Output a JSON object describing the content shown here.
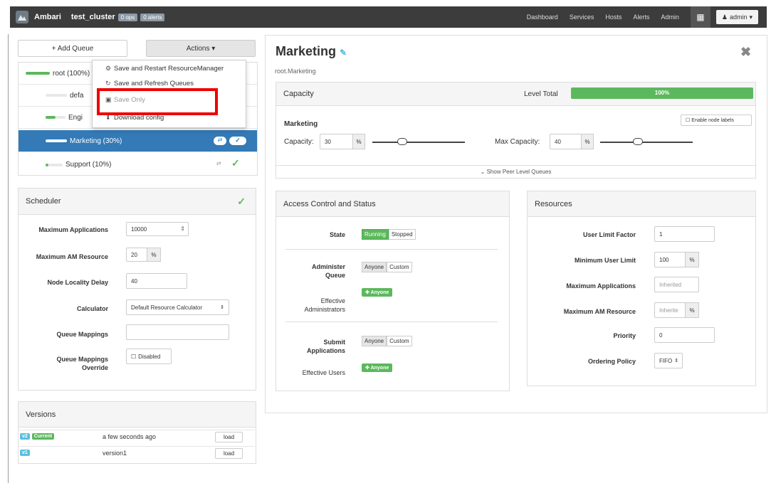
{
  "topbar": {
    "brand": "Ambari",
    "cluster": "test_cluster",
    "ops_badge": "0 ops",
    "alerts_badge": "0 alerts",
    "nav": [
      "Dashboard",
      "Services",
      "Hosts",
      "Alerts",
      "Admin"
    ],
    "admin": "admin"
  },
  "queues": {
    "add_queue": "+ Add Queue",
    "actions": "Actions ▾",
    "items": [
      {
        "label": "root (100%)"
      },
      {
        "label": "defa"
      },
      {
        "label": "Engi"
      },
      {
        "label": "Marketing (30%)"
      },
      {
        "label": "Support (10%)"
      }
    ]
  },
  "actions_menu": {
    "items": [
      "Save and Restart ResourceManager",
      "Save and Refresh Queues",
      "Save Only",
      "Download config"
    ]
  },
  "scheduler": {
    "title": "Scheduler",
    "max_apps_label": "Maximum Applications",
    "max_apps": "10000",
    "max_am_label": "Maximum AM Resource",
    "max_am": "20",
    "percent": "%",
    "locality_label": "Node Locality Delay",
    "locality": "40",
    "calculator_label": "Calculator",
    "calculator": "Default Resource Calculator",
    "mappings_label": "Queue Mappings",
    "mappings": "",
    "override_label_1": "Queue Mappings",
    "override_label_2": "Override",
    "override": "Disabled"
  },
  "versions": {
    "title": "Versions",
    "rows": [
      {
        "tag": "v2",
        "current": "Current",
        "time": "a few seconds ago",
        "load": "load"
      },
      {
        "tag": "v1",
        "time": "version1",
        "load": "load"
      }
    ],
    "colors": {
      "tag": "#5bc0de",
      "current": "#5cb85c"
    }
  },
  "queue_detail": {
    "title": "Marketing",
    "path": "root.Marketing",
    "capacity_title": "Capacity",
    "level_total_label": "Level Total",
    "level_total": "100%",
    "level_total_fraction": 1.0,
    "queue_name": "Marketing",
    "enable_labels": "Enable node labels",
    "capacity_label": "Capacity:",
    "capacity": "30",
    "percent": "%",
    "capacity_fraction": 0.3,
    "max_capacity_label": "Max Capacity:",
    "max_capacity": "40",
    "max_capacity_fraction": 0.4,
    "show_peer": "Show Peer Level Queues"
  },
  "access": {
    "title": "Access Control and Status",
    "state_label": "State",
    "running": "Running",
    "stopped": "Stopped",
    "admin_label_1": "Administer",
    "admin_label_2": "Queue",
    "anyone": "Anyone",
    "custom": "Custom",
    "eff_admin_1": "Effective",
    "eff_admin_2": "Administrators",
    "anyone_badge": "Anyone",
    "submit_label_1": "Submit",
    "submit_label_2": "Applications",
    "eff_users": "Effective Users"
  },
  "resources": {
    "title": "Resources",
    "ulf_label": "User Limit Factor",
    "ulf": "1",
    "mul_label": "Minimum User Limit",
    "mul": "100",
    "max_apps_label": "Maximum Applications",
    "max_apps_placeholder": "Inherited",
    "max_am_label": "Maximum AM Resource",
    "max_am_placeholder": "Inherite",
    "priority_label": "Priority",
    "priority": "0",
    "ordering_label": "Ordering Policy",
    "ordering": "FIFO",
    "percent": "%"
  }
}
